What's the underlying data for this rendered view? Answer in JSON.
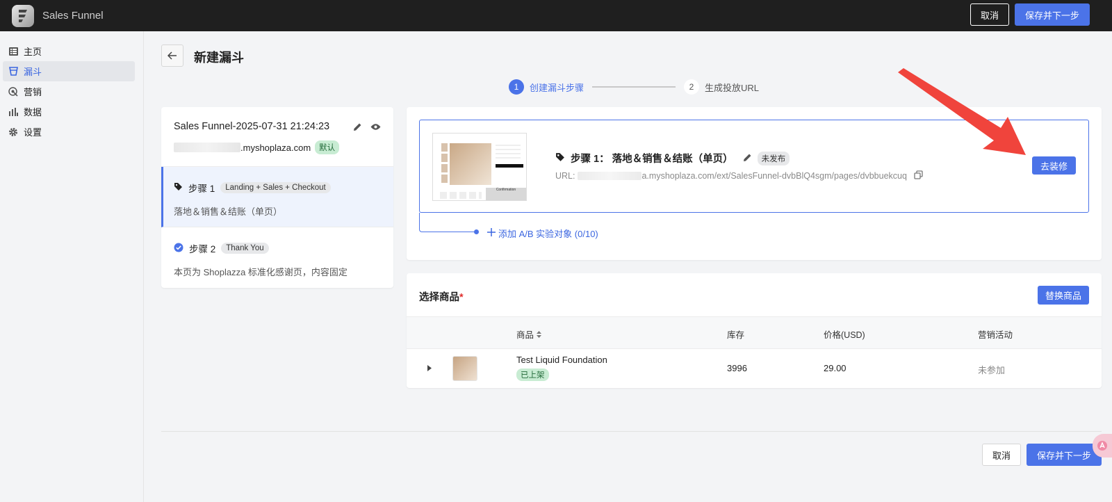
{
  "header": {
    "app_title": "Sales Funnel",
    "cancel_label": "取消",
    "save_next_label": "保存并下一步"
  },
  "sidebar": {
    "items": [
      {
        "label": "主页",
        "icon": "list-icon"
      },
      {
        "label": "漏斗",
        "icon": "funnel-icon",
        "active": true
      },
      {
        "label": "营销",
        "icon": "target-icon"
      },
      {
        "label": "数据",
        "icon": "bar-chart-icon"
      },
      {
        "label": "设置",
        "icon": "gear-icon"
      }
    ]
  },
  "page": {
    "title": "新建漏斗"
  },
  "stepper": {
    "steps": [
      {
        "number": "1",
        "label": "创建漏斗步骤",
        "active": true
      },
      {
        "number": "2",
        "label": "生成投放URL",
        "active": false
      }
    ]
  },
  "funnel": {
    "name": "Sales Funnel-2025-07-31 21:24:23",
    "domain_suffix": ".myshoplaza.com",
    "default_badge": "默认",
    "steps": [
      {
        "title": "步骤 1",
        "tag": "Landing + Sales + Checkout",
        "desc": "落地＆销售＆结账（单页）"
      },
      {
        "title": "步骤 2",
        "tag": "Thank You",
        "desc": "本页为 Shoplazza 标准化感谢页，内容固定"
      }
    ]
  },
  "page_card": {
    "title": "步骤 1： 落地＆销售＆结账（单页）",
    "status": "未发布",
    "url_prefix": "URL:",
    "url_suffix": "a.myshoplaza.com/ext/SalesFunnel-dvbBlQ4sgm/pages/dvbbuekcuq",
    "decorate_label": "去装修",
    "thumb_label": "Confirmation",
    "ab_label": "添加 A/B 实验对象 (0/10)"
  },
  "products": {
    "title": "选择商品",
    "required_mark": "*",
    "replace_label": "替换商品",
    "columns": [
      "商品",
      "库存",
      "价格(USD)",
      "营销活动"
    ],
    "rows": [
      {
        "name": "Test Liquid Foundation",
        "status": "已上架",
        "stock": "3996",
        "price": "29.00",
        "campaign": "未参加"
      }
    ]
  },
  "footer": {
    "cancel_label": "取消",
    "save_next_label": "保存并下一步"
  },
  "colors": {
    "primary": "#4b73e8",
    "topbar": "#1f1f1f",
    "annotation_arrow": "#f0443c"
  }
}
